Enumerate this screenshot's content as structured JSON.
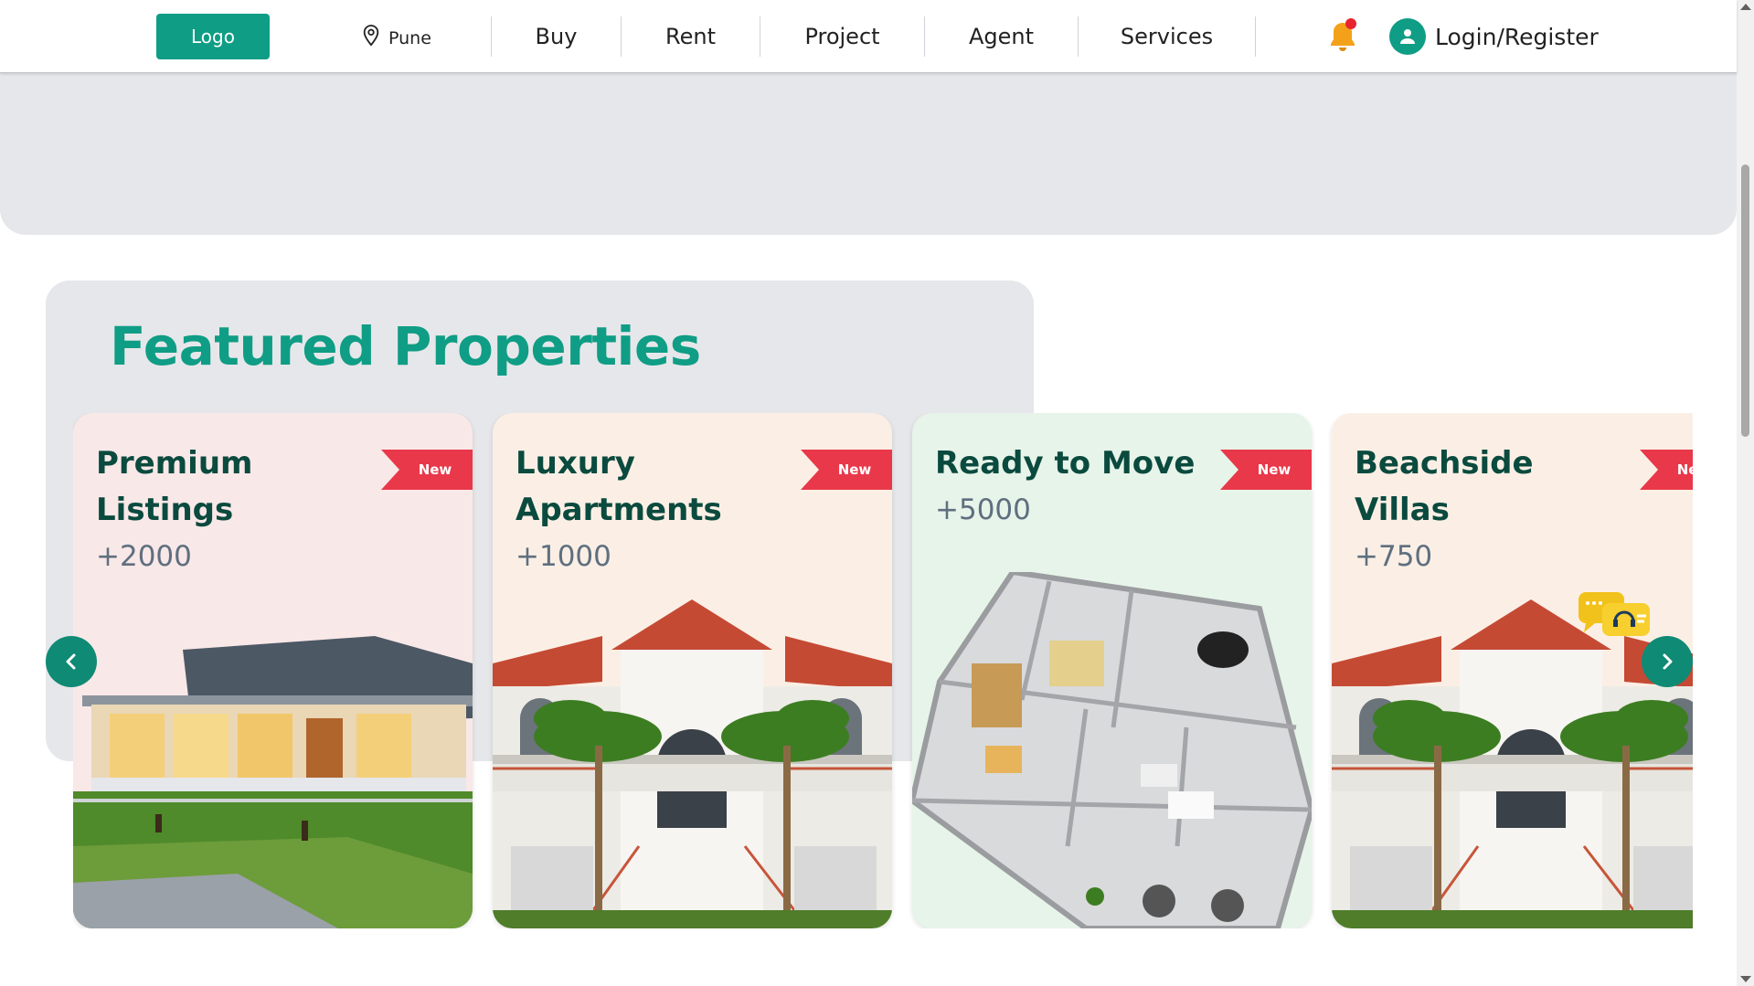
{
  "header": {
    "logo_label": "Logo",
    "location": "Pune",
    "nav": [
      "Buy",
      "Rent",
      "Project",
      "Agent",
      "Services"
    ],
    "login_label": "Login/Register",
    "has_notification": true
  },
  "featured": {
    "title": "Featured Properties",
    "cards": [
      {
        "title": "Premium Listings",
        "count": "+2000",
        "badge": "New",
        "bg": "#f9e8e8",
        "image": "farmhouse-night-icon"
      },
      {
        "title": "Luxury Apartments",
        "count": "+1000",
        "badge": "New",
        "bg": "#fbefe5",
        "image": "villa-house-icon"
      },
      {
        "title": "Ready to Move",
        "count": "+5000",
        "badge": "New",
        "bg": "#e7f4e9",
        "image": "floor-plan-3d-icon"
      },
      {
        "title": "Beachside Villas",
        "count": "+750",
        "badge": "New",
        "bg": "#fbefe5",
        "image": "villa-house-icon"
      }
    ]
  },
  "colors": {
    "brand": "#0f9d85",
    "ribbon": "#e8384a",
    "title": "#0b4a3e"
  }
}
